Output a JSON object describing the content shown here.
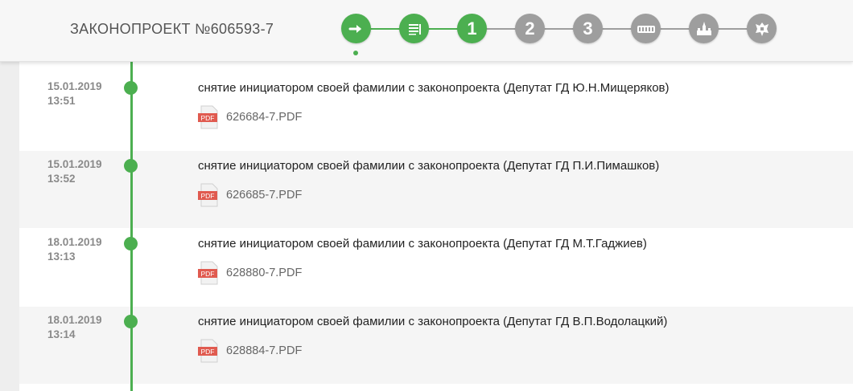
{
  "colors": {
    "accent": "#4caf50",
    "inactive_stage": "#9e9e9e",
    "pdf_red": "#e05a4f"
  },
  "header": {
    "bill_title": "ЗАКОНОПРОЕКТ №606593-7",
    "stages": [
      {
        "id": "introduction",
        "icon": "arrow-right-icon",
        "label": "",
        "state": "done"
      },
      {
        "id": "preliminary",
        "icon": "document-list-icon",
        "label": "",
        "state": "done"
      },
      {
        "id": "reading-1",
        "icon": "",
        "label": "1",
        "state": "done"
      },
      {
        "id": "reading-2",
        "icon": "",
        "label": "2",
        "state": "pending"
      },
      {
        "id": "reading-3",
        "icon": "",
        "label": "3",
        "state": "pending"
      },
      {
        "id": "federation-council",
        "icon": "parliament-building-icon",
        "label": "",
        "state": "pending"
      },
      {
        "id": "president",
        "icon": "kremlin-icon",
        "label": "",
        "state": "pending"
      },
      {
        "id": "publication",
        "icon": "coat-of-arms-icon",
        "label": "",
        "state": "pending"
      }
    ]
  },
  "events": [
    {
      "date": "15.01.2019",
      "time": "13:51",
      "text": "снятие инициатором своей фамилии с законопроекта (Депутат ГД Ю.Н.Мищеряков)",
      "file_icon_label": "PDF",
      "file": "626684-7.PDF"
    },
    {
      "date": "15.01.2019",
      "time": "13:52",
      "text": "снятие инициатором своей фамилии с законопроекта (Депутат ГД П.И.Пимашков)",
      "file_icon_label": "PDF",
      "file": "626685-7.PDF"
    },
    {
      "date": "18.01.2019",
      "time": "13:13",
      "text": "снятие инициатором своей фамилии с законопроекта (Депутат ГД М.Т.Гаджиев)",
      "file_icon_label": "PDF",
      "file": "628880-7.PDF"
    },
    {
      "date": "18.01.2019",
      "time": "13:14",
      "text": "снятие инициатором своей фамилии с законопроекта (Депутат ГД В.П.Водолацкий)",
      "file_icon_label": "PDF",
      "file": "628884-7.PDF"
    }
  ]
}
